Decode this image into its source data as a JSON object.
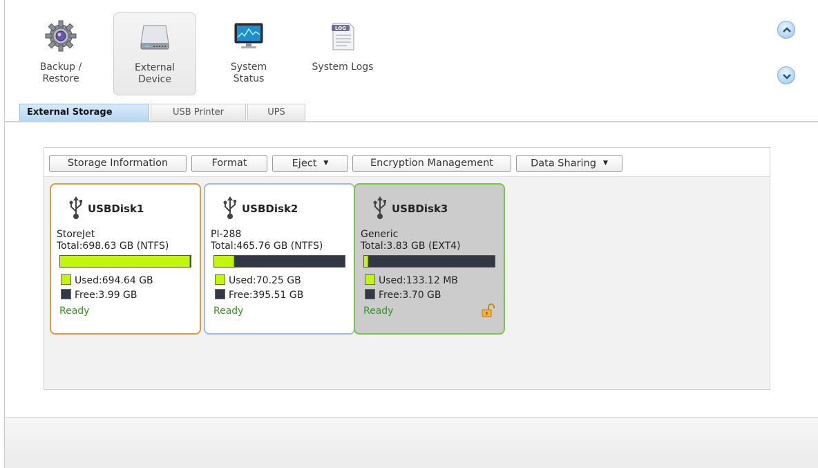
{
  "topnav": {
    "items": [
      {
        "label": "Backup /\nRestore",
        "icon": "gear-icon"
      },
      {
        "label": "External\nDevice",
        "icon": "hard-drive-icon",
        "active": true
      },
      {
        "label": "System\nStatus",
        "icon": "monitor-icon"
      },
      {
        "label": "System Logs",
        "icon": "log-document-icon"
      }
    ],
    "log_icon_text": "LOG"
  },
  "tabs": [
    {
      "label": "External Storage",
      "active": true
    },
    {
      "label": "USB Printer"
    },
    {
      "label": "UPS"
    }
  ],
  "toolbar": {
    "storage_information": "Storage Information",
    "format": "Format",
    "eject": "Eject",
    "encryption_management": "Encryption Management",
    "data_sharing": "Data Sharing"
  },
  "disks": [
    {
      "name": "USBDisk1",
      "vendor": "StoreJet",
      "total": "Total:698.63 GB (NTFS)",
      "used": "Used:694.64 GB",
      "free": "Free:3.99 GB",
      "status": "Ready",
      "used_fraction": 0.994,
      "border_color": "#e29a3c",
      "background": "#ffffff",
      "locked": false
    },
    {
      "name": "USBDisk2",
      "vendor": "PI-288",
      "total": "Total:465.76 GB (NTFS)",
      "used": "Used:70.25 GB",
      "free": "Free:395.51 GB",
      "status": "Ready",
      "used_fraction": 0.151,
      "border_color": "#9dbde0",
      "background": "#ffffff",
      "locked": false
    },
    {
      "name": "USBDisk3",
      "vendor": "Generic",
      "total": "Total:3.83 GB (EXT4)",
      "used": "Used:133.12 MB",
      "free": "Free:3.70 GB",
      "status": "Ready",
      "used_fraction": 0.034,
      "border_color": "#7ec24e",
      "background": "#cccccc",
      "locked": true
    }
  ],
  "colors": {
    "used": "#c2f70a",
    "free": "#333944",
    "status": "#2d9a17",
    "active_tab": "#b7d7f3"
  }
}
